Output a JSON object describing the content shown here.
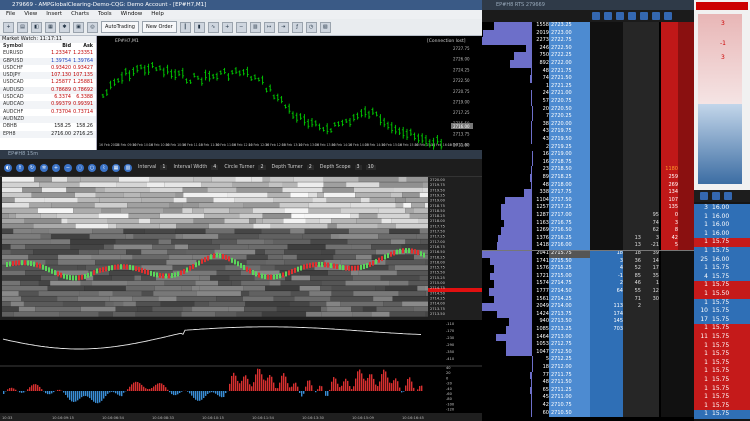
{
  "mt4": {
    "title": "279669 - AMPGlobalClearing-Demo-CQG: Demo Account - [EP#H7,M1]",
    "menu": [
      "File",
      "View",
      "Insert",
      "Charts",
      "Tools",
      "Window",
      "Help"
    ],
    "toolbar": {
      "autotrading": "AutoTrading",
      "new_order": "New Order"
    },
    "market_watch": {
      "title": "Market Watch: 11:17:11",
      "headers": {
        "symbol": "Symbol",
        "bid": "Bid",
        "ask": "Ask"
      },
      "rows": [
        {
          "symbol": "EURUSD",
          "bid": "1.23347",
          "ask": "1.23351",
          "color": "#c00000"
        },
        {
          "symbol": "GBPUSD",
          "bid": "1.39754",
          "ask": "1.39764",
          "color": "#1a3fbf"
        },
        {
          "symbol": "USDCHF",
          "bid": "0.93420",
          "ask": "0.93427",
          "color": "#c00000"
        },
        {
          "symbol": "USDJPY",
          "bid": "107.130",
          "ask": "107.135",
          "color": "#c00000"
        },
        {
          "symbol": "USDCAD",
          "bid": "1.25877",
          "ask": "1.25881",
          "color": "#c00000"
        },
        {
          "symbol": "AUDUSD",
          "bid": "0.78689",
          "ask": "0.78692",
          "color": "#c00000"
        },
        {
          "symbol": "USDCAD",
          "bid": "6.3374",
          "ask": "6.3388",
          "color": "#c00000"
        },
        {
          "symbol": "AUDCAD",
          "bid": "0.99379",
          "ask": "0.99391",
          "color": "#c00000"
        },
        {
          "symbol": "AUDCHF",
          "bid": "0.73704",
          "ask": "0.73714",
          "color": "#c00000"
        },
        {
          "symbol": "AUDNZD",
          "bid": "",
          "ask": "",
          "color": "#c00000"
        },
        {
          "symbol": "DBHB",
          "bid": "158.25",
          "ask": "158.26",
          "color": "#111111"
        },
        {
          "symbol": "EPH8",
          "bid": "2716.00",
          "ask": "2716.25",
          "color": "#111111"
        }
      ]
    },
    "chart": {
      "label": "EP#H7,M1",
      "connection": "[Connection lost]",
      "yticks": [
        "2727.75",
        "2726.00",
        "2724.25",
        "2722.50",
        "2720.75",
        "2719.00",
        "2717.25",
        "2715.50",
        "2713.75",
        "2711.80"
      ],
      "price_tag": "2716.00",
      "xticks": [
        "16 Feb 2018",
        "16 Feb 09:50",
        "16 Feb 10:10",
        "16 Feb 10:30",
        "16 Feb 10:50",
        "16 Feb 11:10",
        "16 Feb 11:30",
        "16 Feb 11:50",
        "16 Feb 12:10",
        "16 Feb 12:30",
        "16 Feb 12:50",
        "16 Feb 13:10",
        "16 Feb 13:30",
        "16 Feb 13:50",
        "16 Feb 14:10",
        "16 Feb 14:30",
        "16 Feb 14:50",
        "16 Feb 15:10",
        "16 Feb 15:30",
        "16 Feb 15:50",
        "16 Feb 16:10",
        "16 Feb 11:00"
      ]
    }
  },
  "orderflow": {
    "title": "EP#H8 15m",
    "controls": [
      {
        "label": "Interval",
        "value": "1"
      },
      {
        "label": "Interval Width",
        "value": "4"
      },
      {
        "label": "Circle Turner",
        "value": "2"
      },
      {
        "label": "Depth Turner",
        "value": "2"
      },
      {
        "label": "Depth Scope",
        "value": "3"
      },
      {
        "label": "",
        "value": "10"
      }
    ],
    "yticks": [
      "2720.00",
      "2719.75",
      "2719.50",
      "2719.25",
      "2719.00",
      "2718.75",
      "2718.50",
      "2718.25",
      "2718.00",
      "2717.75",
      "2717.50",
      "2717.25",
      "2717.00",
      "2716.75",
      "2716.50",
      "2716.25",
      "2716.00",
      "2715.75",
      "2715.50",
      "2715.25",
      "2715.00",
      "2714.75",
      "2714.50",
      "2714.25",
      "2714.00",
      "2713.75",
      "2713.50"
    ],
    "cvd_ticks": [
      "-110",
      "-170",
      "-230",
      "-290",
      "-350",
      "-410"
    ],
    "delta_ticks": [
      "40",
      "20",
      "0",
      "-20",
      "-40",
      "-60",
      "-80",
      "-100",
      "-120"
    ],
    "xticks": [
      "10:33",
      "10:16:09:15",
      "10:16:06:54",
      "10:16:08:33",
      "10:16:10:15",
      "10:16:11:54",
      "10:16:13:30",
      "10:16:15:09",
      "10:16:16:45"
    ]
  },
  "dom": {
    "title": "EP#H8 RTS 279669",
    "rows": [
      {
        "v": "1558",
        "p": "2723.25",
        "b": "",
        "m1": "",
        "m2": "",
        "a": ""
      },
      {
        "v": "2019",
        "p": "2723.00",
        "b": "",
        "m1": "",
        "m2": "",
        "a": ""
      },
      {
        "v": "2273",
        "p": "2722.75",
        "b": "",
        "m1": "",
        "m2": "",
        "a": ""
      },
      {
        "v": "246",
        "p": "2722.50",
        "b": "",
        "m1": "",
        "m2": "",
        "a": ""
      },
      {
        "v": "750",
        "p": "2722.25",
        "b": "",
        "m1": "",
        "m2": "",
        "a": ""
      },
      {
        "v": "892",
        "p": "2722.00",
        "b": "",
        "m1": "",
        "m2": "",
        "a": ""
      },
      {
        "v": "48",
        "p": "2721.75",
        "b": "",
        "m1": "",
        "m2": "",
        "a": ""
      },
      {
        "v": "74",
        "p": "2721.50",
        "b": "",
        "m1": "",
        "m2": "",
        "a": ""
      },
      {
        "v": "1",
        "p": "2721.25",
        "b": "",
        "m1": "",
        "m2": "",
        "a": ""
      },
      {
        "v": "24",
        "p": "2721.00",
        "b": "",
        "m1": "",
        "m2": "",
        "a": ""
      },
      {
        "v": "57",
        "p": "2720.75",
        "b": "",
        "m1": "",
        "m2": "",
        "a": ""
      },
      {
        "v": "20",
        "p": "2720.50",
        "b": "",
        "m1": "",
        "m2": "",
        "a": ""
      },
      {
        "v": "7",
        "p": "2720.25",
        "b": "",
        "m1": "",
        "m2": "",
        "a": ""
      },
      {
        "v": "38",
        "p": "2720.00",
        "b": "",
        "m1": "",
        "m2": "",
        "a": ""
      },
      {
        "v": "43",
        "p": "2719.75",
        "b": "",
        "m1": "",
        "m2": "",
        "a": ""
      },
      {
        "v": "43",
        "p": "2719.50",
        "b": "",
        "m1": "",
        "m2": "",
        "a": ""
      },
      {
        "v": "2",
        "p": "2719.25",
        "b": "",
        "m1": "",
        "m2": "",
        "a": ""
      },
      {
        "v": "16",
        "p": "2719.00",
        "b": "",
        "m1": "",
        "m2": "",
        "a": ""
      },
      {
        "v": "16",
        "p": "2718.75",
        "b": "",
        "m1": "",
        "m2": "",
        "a": ""
      },
      {
        "v": "23",
        "p": "2718.50",
        "b": "",
        "m1": "",
        "m2": "",
        "a": "1180"
      },
      {
        "v": "89",
        "p": "2718.25",
        "b": "",
        "m1": "",
        "m2": "",
        "a": "259"
      },
      {
        "v": "48",
        "p": "2718.00",
        "b": "",
        "m1": "",
        "m2": "",
        "a": "269"
      },
      {
        "v": "338",
        "p": "2717.75",
        "b": "",
        "m1": "",
        "m2": "",
        "a": "134"
      },
      {
        "v": "1104",
        "p": "2717.50",
        "b": "",
        "m1": "",
        "m2": "",
        "a": "107"
      },
      {
        "v": "1257",
        "p": "2717.25",
        "b": "",
        "m1": "",
        "m2": "",
        "a": "135"
      },
      {
        "v": "1287",
        "p": "2717.00",
        "b": "",
        "m1": "",
        "m2": "95",
        "a": "0"
      },
      {
        "v": "1163",
        "p": "2716.75",
        "b": "",
        "m1": "",
        "m2": "74",
        "a": "3"
      },
      {
        "v": "1269",
        "p": "2716.50",
        "b": "",
        "m1": "",
        "m2": "62",
        "a": "8"
      },
      {
        "v": "1376",
        "p": "2716.25",
        "b": "",
        "m1": "13",
        "m2": "3",
        "a": "42"
      },
      {
        "v": "1418",
        "p": "2716.00",
        "b": "",
        "m1": "13",
        "m2": "-21",
        "a": "5"
      },
      {
        "v": "2041",
        "p": "2715.75",
        "b": "18",
        "m1": "18",
        "m2": "39",
        "a": ""
      },
      {
        "v": "1741",
        "p": "2715.50",
        "b": "3",
        "m1": "36",
        "m2": "14",
        "a": ""
      },
      {
        "v": "1576",
        "p": "2715.25",
        "b": "4",
        "m1": "52",
        "m2": "17",
        "a": ""
      },
      {
        "v": "1721",
        "p": "2715.00",
        "b": "-1",
        "m1": "85",
        "m2": "35",
        "a": ""
      },
      {
        "v": "1574",
        "p": "2714.75",
        "b": "2",
        "m1": "46",
        "m2": "1",
        "a": ""
      },
      {
        "v": "1777",
        "p": "2714.50",
        "b": "64",
        "m1": "55",
        "m2": "12",
        "a": ""
      },
      {
        "v": "1561",
        "p": "2714.25",
        "b": "",
        "m1": "71",
        "m2": "30",
        "a": ""
      },
      {
        "v": "2049",
        "p": "2714.00",
        "b": "113",
        "m1": "2",
        "m2": "",
        "a": ""
      },
      {
        "v": "1424",
        "p": "2713.75",
        "b": "174",
        "m1": "",
        "m2": "",
        "a": ""
      },
      {
        "v": "940",
        "p": "2713.50",
        "b": "145",
        "m1": "",
        "m2": "",
        "a": ""
      },
      {
        "v": "1085",
        "p": "2713.25",
        "b": "703",
        "m1": "",
        "m2": "",
        "a": ""
      },
      {
        "v": "1464",
        "p": "2713.00",
        "b": "",
        "m1": "",
        "m2": "",
        "a": ""
      },
      {
        "v": "1053",
        "p": "2712.75",
        "b": "",
        "m1": "",
        "m2": "",
        "a": ""
      },
      {
        "v": "1047",
        "p": "2712.50",
        "b": "",
        "m1": "",
        "m2": "",
        "a": ""
      },
      {
        "v": "5",
        "p": "2712.25",
        "b": "",
        "m1": "",
        "m2": "",
        "a": ""
      },
      {
        "v": "18",
        "p": "2712.00",
        "b": "",
        "m1": "",
        "m2": "",
        "a": ""
      },
      {
        "v": "77",
        "p": "2711.75",
        "b": "",
        "m1": "",
        "m2": "",
        "a": ""
      },
      {
        "v": "48",
        "p": "2711.50",
        "b": "",
        "m1": "",
        "m2": "",
        "a": ""
      },
      {
        "v": "65",
        "p": "2711.25",
        "b": "",
        "m1": "",
        "m2": "",
        "a": ""
      },
      {
        "v": "45",
        "p": "2711.00",
        "b": "",
        "m1": "",
        "m2": "",
        "a": ""
      },
      {
        "v": "42",
        "p": "2710.75",
        "b": "",
        "m1": "",
        "m2": "",
        "a": ""
      },
      {
        "v": "60",
        "p": "2710.50",
        "b": "",
        "m1": "",
        "m2": "",
        "a": ""
      }
    ]
  },
  "side": {
    "top_values": [
      "3",
      "-1",
      "3"
    ],
    "rows": [
      {
        "v": "3",
        "p": "16.00",
        "c": "blue"
      },
      {
        "v": "1",
        "p": "16.00",
        "c": "blue"
      },
      {
        "v": "1",
        "p": "16.00",
        "c": "blue"
      },
      {
        "v": "1",
        "p": "16.00",
        "c": "blue"
      },
      {
        "v": "1",
        "p": "15.75",
        "c": "red"
      },
      {
        "v": "1",
        "p": "15.75",
        "c": "blue"
      },
      {
        "v": "25",
        "p": "16.00",
        "c": "blue"
      },
      {
        "v": "1",
        "p": "15.75",
        "c": "blue"
      },
      {
        "v": "4",
        "p": "15.75",
        "c": "blue"
      },
      {
        "v": "1",
        "p": "15.75",
        "c": "red"
      },
      {
        "v": "1",
        "p": "15.50",
        "c": "red"
      },
      {
        "v": "1",
        "p": "15.75",
        "c": "blue"
      },
      {
        "v": "10",
        "p": "15.75",
        "c": "blue"
      },
      {
        "v": "17",
        "p": "15.75",
        "c": "blue"
      },
      {
        "v": "1",
        "p": "15.75",
        "c": "red"
      },
      {
        "v": "11",
        "p": "15.75",
        "c": "red"
      },
      {
        "v": "1",
        "p": "15.75",
        "c": "red"
      },
      {
        "v": "1",
        "p": "15.75",
        "c": "red"
      },
      {
        "v": "1",
        "p": "15.75",
        "c": "red"
      },
      {
        "v": "1",
        "p": "15.75",
        "c": "red"
      },
      {
        "v": "1",
        "p": "15.75",
        "c": "red"
      },
      {
        "v": "1",
        "p": "15.75",
        "c": "red"
      },
      {
        "v": "1",
        "p": "15.75",
        "c": "red"
      },
      {
        "v": "1",
        "p": "15.75",
        "c": "red"
      },
      {
        "v": "1",
        "p": "15.75",
        "c": "blue"
      }
    ]
  }
}
